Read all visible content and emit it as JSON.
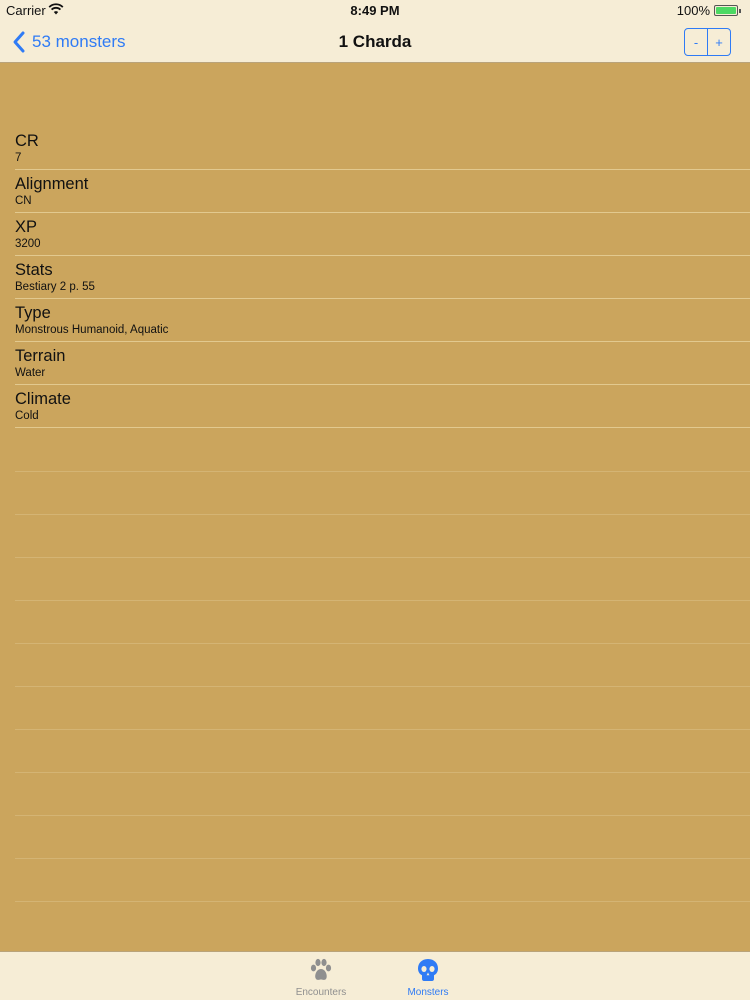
{
  "status_bar": {
    "carrier": "Carrier",
    "time": "8:49 PM",
    "battery": "100%"
  },
  "nav": {
    "back_label": "53 monsters",
    "title": "1 Charda",
    "minus_label": "-",
    "plus_label": "+"
  },
  "rows": [
    {
      "title": "CR",
      "value": "7"
    },
    {
      "title": "Alignment",
      "value": "CN"
    },
    {
      "title": "XP",
      "value": "3200"
    },
    {
      "title": "Stats",
      "value": "Bestiary 2 p. 55"
    },
    {
      "title": "Type",
      "value": "Monstrous Humanoid, Aquatic"
    },
    {
      "title": "Terrain",
      "value": "Water"
    },
    {
      "title": "Climate",
      "value": "Cold"
    }
  ],
  "tabs": [
    {
      "label": "Encounters",
      "icon": "paw-icon",
      "selected": false
    },
    {
      "label": "Monsters",
      "icon": "skull-icon",
      "selected": true
    }
  ],
  "colors": {
    "background": "#cba55d",
    "bar": "#f6edd6",
    "accent": "#2f7bf5",
    "inactive_tab": "#8f8f8f"
  }
}
